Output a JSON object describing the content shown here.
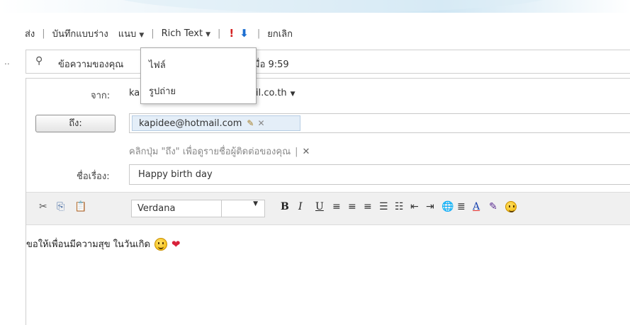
{
  "toolbar": {
    "send": "ส่ง",
    "save_draft": "บันทึกแบบร่าง",
    "attach": "แนบ",
    "format_mode": "Rich Text",
    "high_importance": "!",
    "low_importance": "⬇",
    "cancel": "ยกเลิก"
  },
  "attach_menu": {
    "items": [
      "ไฟล์",
      "รูปถ่าย"
    ]
  },
  "info_bar": {
    "text_visible": "ข้อความของคุณ",
    "text_end": "มื่อ 9:59"
  },
  "from": {
    "label": "จาก:",
    "address_start": "ka",
    "address_end": "ail.co.th"
  },
  "to": {
    "button_label": "ถึง:",
    "recipient": "kapidee@hotmail.com"
  },
  "hint": {
    "text": "คลิกปุ่ม \"ถึง\" เพื่อดูรายชื่อผู้ติดต่อของคุณ"
  },
  "subject": {
    "label": "ชื่อเรื่อง:",
    "value": "Happy birth day"
  },
  "formatting": {
    "font": "Verdana",
    "size": "",
    "icons": [
      "cut-icon",
      "copy-icon",
      "paste-icon",
      "bold-icon",
      "italic-icon",
      "underline-icon",
      "align-left-icon",
      "align-center-icon",
      "align-right-icon",
      "numbered-list-icon",
      "bulleted-list-icon",
      "outdent-icon",
      "indent-icon",
      "link-icon",
      "line-spacing-icon",
      "font-color-icon",
      "highlight-icon",
      "emoticon-icon"
    ]
  },
  "body": {
    "text": "ขอให้เพื่อนมีความสุข ในวันเกิด"
  },
  "colors": {
    "high_importance": "#d32020",
    "low_importance": "#1d6fd1",
    "chip_background": "#e4eef8",
    "toolbar_background": "#f0f0f0",
    "accent_band": "#cfe6f3"
  }
}
